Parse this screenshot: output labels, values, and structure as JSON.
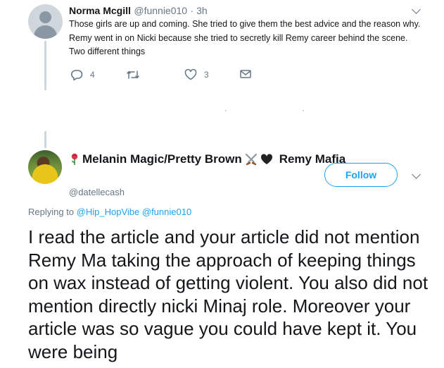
{
  "tweet1": {
    "author_name": "Norma Mcgill",
    "author_handle": "@funnie010",
    "time": "· 3h",
    "text": "Those girls are up and coming. She tried to give them the best advice and the reason why. Remy went in on Nicki because she tried to secretly kill Remy career behind the scene. Two different things",
    "reply_count": "4",
    "retweet_count": "",
    "like_count": "3",
    "icons": {
      "reply": "reply-icon",
      "retweet": "retweet-icon",
      "like": "heart-icon",
      "dm": "envelope-icon",
      "menu": "chevron-down-icon"
    }
  },
  "tweet2": {
    "author_name": "Melanin Magic/Pretty Brown",
    "author_name_suffix": "Remy Mafia",
    "author_handle": "@datellecash",
    "follow_label": "Follow",
    "replying_prefix": "Replying to",
    "replying_to_1": "@Hip_HopVibe",
    "replying_to_2": "@funnie010",
    "text": "I read the article and your article did not mention Remy Ma taking the approach of keeping things on wax instead of getting violent. You also did not mention directly nicki Minaj role. Moreover your article was so vague you could have kept it. You were being",
    "icons": {
      "rose": "rose-emoji-icon",
      "swords": "crossed-swords-icon",
      "heart": "black-heart-icon",
      "menu": "chevron-down-icon"
    }
  },
  "colors": {
    "accent": "#1da1f2",
    "muted": "#657786",
    "text": "#14171a",
    "thread_line": "#ccd6dd"
  }
}
